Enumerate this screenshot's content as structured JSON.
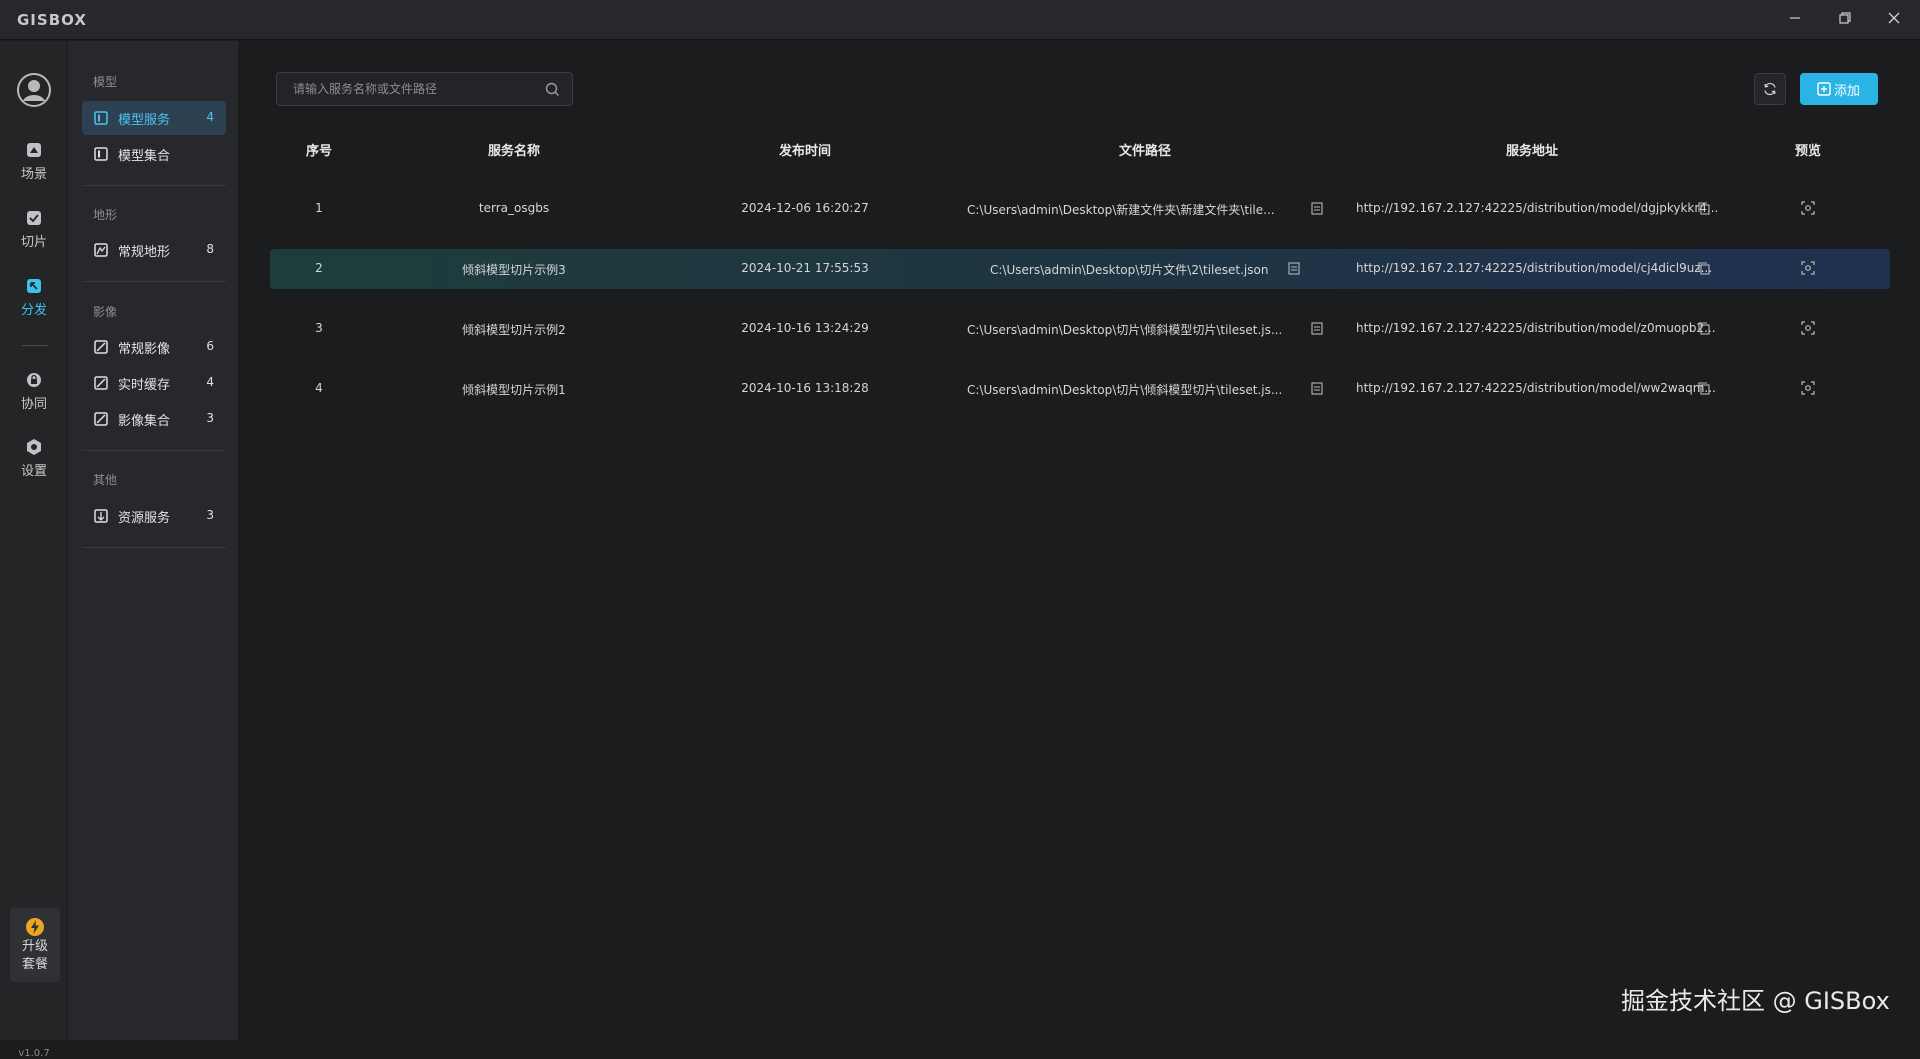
{
  "app": {
    "logo": "GISBOX",
    "window_controls": [
      "minimize-icon",
      "restore-icon",
      "close-icon"
    ]
  },
  "rail": {
    "items": [
      {
        "label": "场景",
        "icon": "scene-icon"
      },
      {
        "label": "切片",
        "icon": "slice-icon"
      },
      {
        "label": "分发",
        "icon": "distribute-icon",
        "active": true
      },
      {
        "label": "协同",
        "icon": "collab-icon"
      },
      {
        "label": "设置",
        "icon": "settings-icon"
      }
    ],
    "upgrade_label": "升级套餐",
    "version": "v1.0.7"
  },
  "sidebar": {
    "groups": [
      {
        "title": "模型",
        "items": [
          {
            "label": "模型服务",
            "count": "4",
            "active": true
          },
          {
            "label": "模型集合",
            "count": ""
          }
        ]
      },
      {
        "title": "地形",
        "items": [
          {
            "label": "常规地形",
            "count": "8"
          }
        ]
      },
      {
        "title": "影像",
        "items": [
          {
            "label": "常规影像",
            "count": "6"
          },
          {
            "label": "实时缓存",
            "count": "4"
          },
          {
            "label": "影像集合",
            "count": "3"
          }
        ]
      },
      {
        "title": "其他",
        "items": [
          {
            "label": "资源服务",
            "count": "3"
          }
        ]
      }
    ]
  },
  "toolbar": {
    "search_placeholder": "请输入服务名称或文件路径",
    "add_label": "添加"
  },
  "table": {
    "headers": [
      "序号",
      "服务名称",
      "发布时间",
      "文件路径",
      "服务地址",
      "预览"
    ],
    "rows": [
      {
        "index": "1",
        "name": "terra_osgbs",
        "time": "2024-12-06 16:20:27",
        "path": "C:\\Users\\admin\\Desktop\\新建文件夹\\新建文件夹\\tile...",
        "url": "http://192.167.2.127:42225/distribution/model/dgjpkykkr4..."
      },
      {
        "index": "2",
        "name": "倾斜模型切片示例3",
        "time": "2024-10-21 17:55:53",
        "path": "C:\\Users\\admin\\Desktop\\切片文件\\2\\tileset.json",
        "url": "http://192.167.2.127:42225/distribution/model/cj4dicl9uz...",
        "selected": true
      },
      {
        "index": "3",
        "name": "倾斜模型切片示例2",
        "time": "2024-10-16 13:24:29",
        "path": "C:\\Users\\admin\\Desktop\\切片\\倾斜模型切片\\tileset.js...",
        "url": "http://192.167.2.127:42225/distribution/model/z0muopb2..."
      },
      {
        "index": "4",
        "name": "倾斜模型切片示例1",
        "time": "2024-10-16 13:18:28",
        "path": "C:\\Users\\admin\\Desktop\\切片\\倾斜模型切片\\tileset.js...",
        "url": "http://192.167.2.127:42225/distribution/model/ww2waqm..."
      }
    ]
  },
  "watermark": "掘金技术社区 @ GISBox"
}
